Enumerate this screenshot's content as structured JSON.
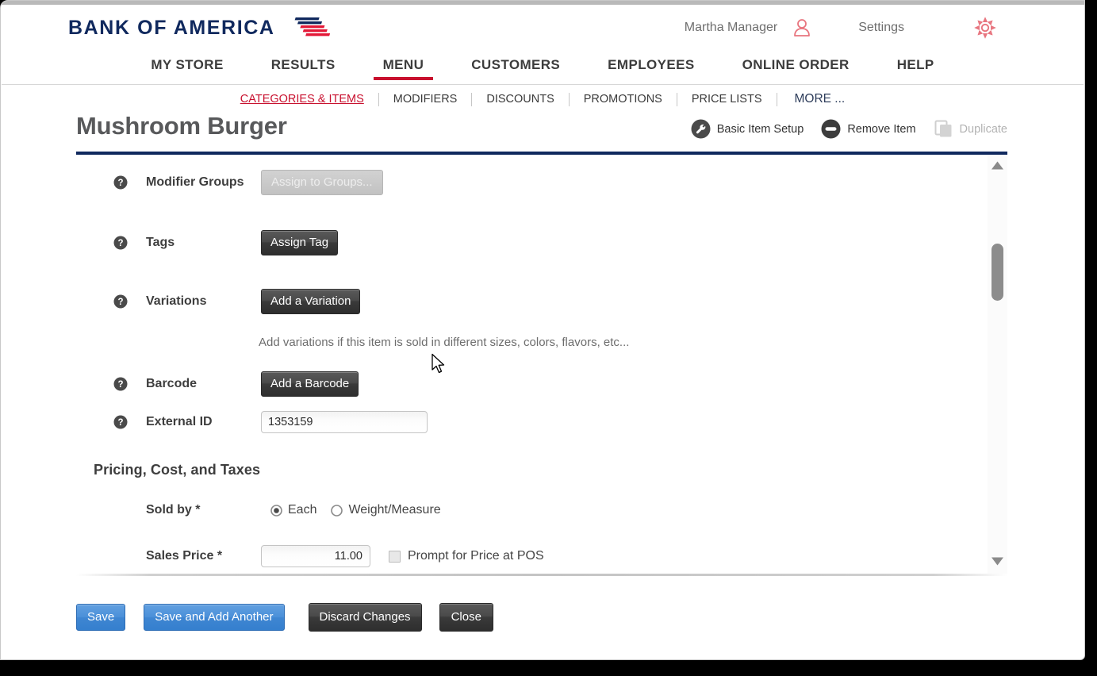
{
  "brand": {
    "name": "BANK OF AMERICA",
    "logo_icon": "flag-logo-icon",
    "colors": {
      "navy": "#10295e",
      "red": "#c8102e"
    }
  },
  "header": {
    "account_name": "Martha Manager",
    "account_icon": "user-icon",
    "settings_label": "Settings",
    "settings_icon": "gear-icon"
  },
  "main_nav": {
    "items": [
      {
        "label": "MY STORE",
        "active": false
      },
      {
        "label": "RESULTS",
        "active": false
      },
      {
        "label": "MENU",
        "active": true
      },
      {
        "label": "CUSTOMERS",
        "active": false
      },
      {
        "label": "EMPLOYEES",
        "active": false
      },
      {
        "label": "ONLINE ORDER",
        "active": false
      },
      {
        "label": "HELP",
        "active": false
      }
    ]
  },
  "sub_nav": {
    "items": [
      {
        "label": "CATEGORIES & ITEMS",
        "active": true
      },
      {
        "label": "MODIFIERS",
        "active": false
      },
      {
        "label": "DISCOUNTS",
        "active": false
      },
      {
        "label": "PROMOTIONS",
        "active": false
      },
      {
        "label": "PRICE LISTS",
        "active": false
      }
    ],
    "more_label": "MORE ..."
  },
  "page": {
    "title": "Mushroom Burger",
    "actions": [
      {
        "label": "Basic Item Setup",
        "icon": "wrench-icon",
        "disabled": false
      },
      {
        "label": "Remove Item",
        "icon": "minus-circle-icon",
        "disabled": false
      },
      {
        "label": "Duplicate",
        "icon": "copy-icon",
        "disabled": true
      }
    ]
  },
  "form": {
    "help_icon": "question-mark-icon",
    "modifier_groups": {
      "label": "Modifier Groups",
      "button_label": "Assign to Groups...",
      "disabled": true
    },
    "tags": {
      "label": "Tags",
      "button_label": "Assign Tag"
    },
    "variations": {
      "label": "Variations",
      "button_label": "Add a Variation",
      "hint": "Add variations if this item is sold in different sizes, colors, flavors, etc..."
    },
    "barcode": {
      "label": "Barcode",
      "button_label": "Add a Barcode"
    },
    "external_id": {
      "label": "External ID",
      "value": "1353159",
      "placeholder": ""
    }
  },
  "pricing": {
    "section_heading": "Pricing, Cost, and Taxes",
    "sold_by": {
      "label": "Sold by *",
      "options": [
        {
          "label": "Each",
          "selected": true
        },
        {
          "label": "Weight/Measure",
          "selected": false
        }
      ]
    },
    "sales_price": {
      "label": "Sales Price *",
      "value": "11.00",
      "placeholder": "",
      "prompt_label": "Prompt for Price at POS",
      "prompt_checked": false
    }
  },
  "scrollbar": {
    "up_icon": "triangle-up-icon",
    "down_icon": "triangle-down-icon",
    "thumb": "scroll-thumb"
  },
  "footer": {
    "buttons": [
      {
        "label": "Save",
        "style": "primary"
      },
      {
        "label": "Save and Add Another",
        "style": "primary"
      },
      {
        "label": "Discard Changes",
        "style": "secondary"
      },
      {
        "label": "Close",
        "style": "secondary"
      }
    ]
  },
  "cursor": {
    "icon": "arrow-cursor-icon"
  }
}
